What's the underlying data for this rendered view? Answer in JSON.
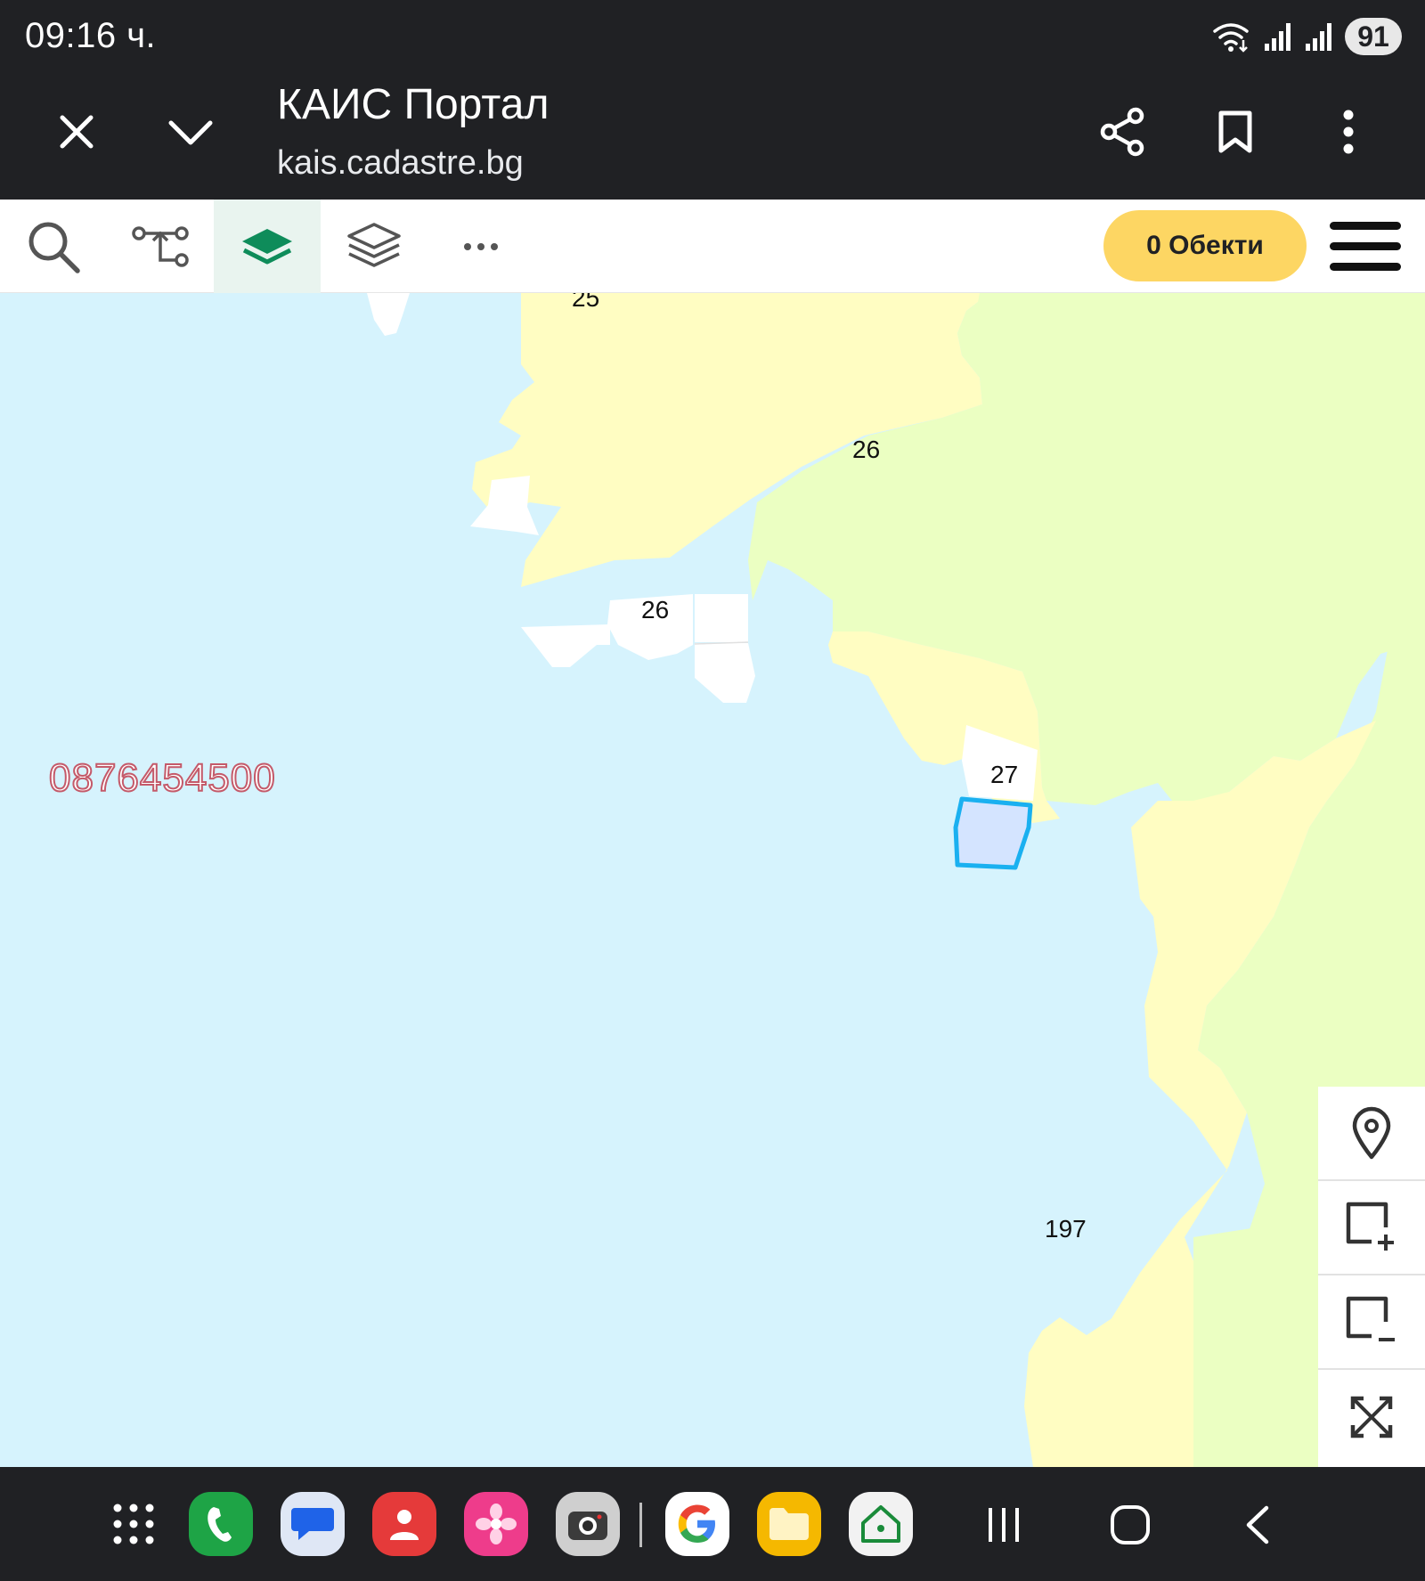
{
  "status_bar": {
    "time": "09:16 ч.",
    "battery": "91",
    "icons": [
      "wifi-icon",
      "signal-1-icon",
      "signal-2-icon",
      "battery-icon"
    ]
  },
  "browser": {
    "title": "КАИС Портал",
    "url": "kais.cadastre.bg",
    "icons": [
      "close-icon",
      "chevron-down-icon",
      "share-icon",
      "bookmark-icon",
      "more-vert-icon"
    ]
  },
  "toolbar": {
    "tools": [
      "search-icon",
      "route-icon",
      "layers-filled-icon",
      "layers-outline-icon",
      "more-horiz-icon"
    ],
    "active_tool": "layers-filled-icon",
    "objects_label": "0 Обекти",
    "menu_icon": "hamburger-icon"
  },
  "map": {
    "labels": {
      "l25": "25",
      "l26a": "26",
      "l26b": "26",
      "l27": "27",
      "l197": "197"
    },
    "watermark": "0876454500",
    "colors": {
      "water": "#d6f3fd",
      "land_yellow": "#fffdc2",
      "land_green": "#ebffc2",
      "parcel_white": "#ffffff",
      "selected_fill": "#d4e4ff",
      "selected_stroke": "#1ab0f0"
    },
    "controls": [
      "location-pin-icon",
      "zoom-in-box-icon",
      "zoom-out-box-icon",
      "fullscreen-icon"
    ]
  },
  "dock": {
    "apps": [
      "app-drawer-icon",
      "phone-app-icon",
      "messages-app-icon",
      "contacts-app-icon",
      "gallery-app-icon",
      "camera-app-icon",
      "google-app-icon",
      "files-app-icon",
      "smart-home-app-icon"
    ],
    "nav": [
      "recents-icon",
      "home-icon",
      "back-icon"
    ],
    "colors": {
      "phone": "#1ea446",
      "messages": "#dfe7f5",
      "contacts": "#e53a3a",
      "gallery": "#ee3c8b",
      "camera": "#cfcfcf",
      "google": "#ffffff",
      "files": "#f5b800",
      "smart_home": "#f2f2f2"
    }
  }
}
